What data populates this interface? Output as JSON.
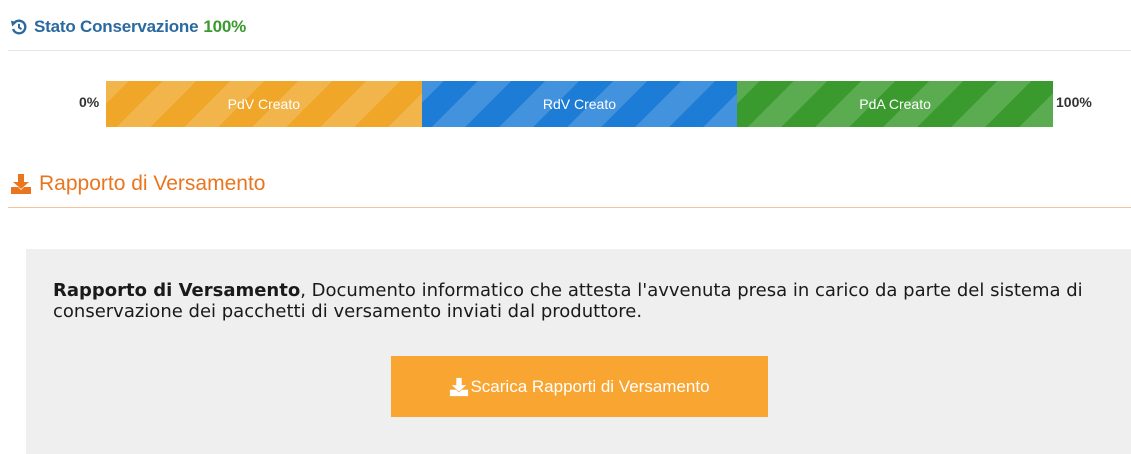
{
  "status": {
    "label": "Stato Conservazione",
    "percent": "100%",
    "icon": "history-icon",
    "label_color": "#2a6aa0",
    "percent_color": "#3a9a2e"
  },
  "progress": {
    "start_label": "0%",
    "end_label": "100%",
    "segments": [
      {
        "label": "PdV Creato",
        "value": 33.33,
        "color": "#f0a628"
      },
      {
        "label": "RdV Creato",
        "value": 33.33,
        "color": "#1d7cd6"
      },
      {
        "label": "PdA Creato",
        "value": 33.34,
        "color": "#3a9a2e"
      }
    ]
  },
  "section": {
    "title": "Rapporto di Versamento",
    "icon": "download-icon",
    "color": "#e9761f"
  },
  "panel": {
    "bold_text": "Rapporto di Versamento",
    "text": ", Documento informatico che attesta l'avvenuta presa in carico da parte del sistema di conservazione dei pacchetti di versamento inviati dal produttore.",
    "button_label": "Scarica Rapporti di Versamento",
    "button_icon": "download-icon",
    "button_color": "#f8a532"
  }
}
